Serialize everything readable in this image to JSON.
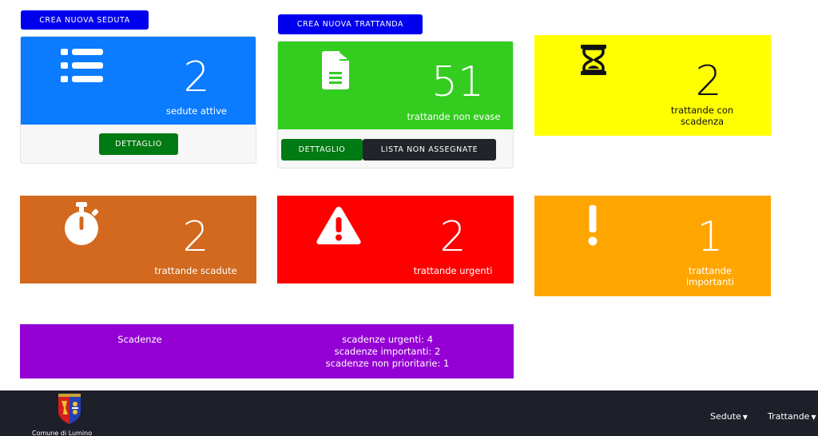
{
  "buttons": {
    "crea_seduta": "CREA NUOVA SEDUTA",
    "crea_trattanda": "CREA NUOVA TRATTANDA",
    "dettaglio_sedute": "DETTAGLIO",
    "dettaglio_trattande": "DETTAGLIO",
    "lista_non_assegnate": "LISTA NON ASSEGNATE"
  },
  "tiles": {
    "sedute_attive": {
      "count": "2",
      "label": "sedute attive",
      "color": "#0b7bff"
    },
    "non_evase": {
      "count": "51",
      "label": "trattande non evase",
      "color": "#33cc1f"
    },
    "scadenza": {
      "count": "2",
      "label_line1": "trattande con",
      "label_line2": "scadenza",
      "color": "#ffff00"
    },
    "scadute": {
      "count": "2",
      "label": "trattande scadute",
      "color": "#d2691e"
    },
    "urgenti": {
      "count": "2",
      "label": "trattande urgenti",
      "color": "#ff0000"
    },
    "importanti": {
      "count": "1",
      "label_line1": "trattande",
      "label_line2": "importanti",
      "color": "#ffa500"
    }
  },
  "scadenze": {
    "title": "Scadenze",
    "urgenti": "scadenze urgenti: 4",
    "importanti": "scadenze importanti: 2",
    "non_prioritarie": "scadenze non prioritarie: 1",
    "color": "#9400d3"
  },
  "footer": {
    "brand": "Comune di Lumino",
    "nav_sedute": "Sedute",
    "nav_trattande": "Trattande"
  },
  "icons": {
    "list": "list-icon",
    "file": "file-icon",
    "hourglass": "hourglass-icon",
    "stopwatch": "stopwatch-icon",
    "warning": "warning-icon",
    "exclamation": "exclamation-icon"
  }
}
